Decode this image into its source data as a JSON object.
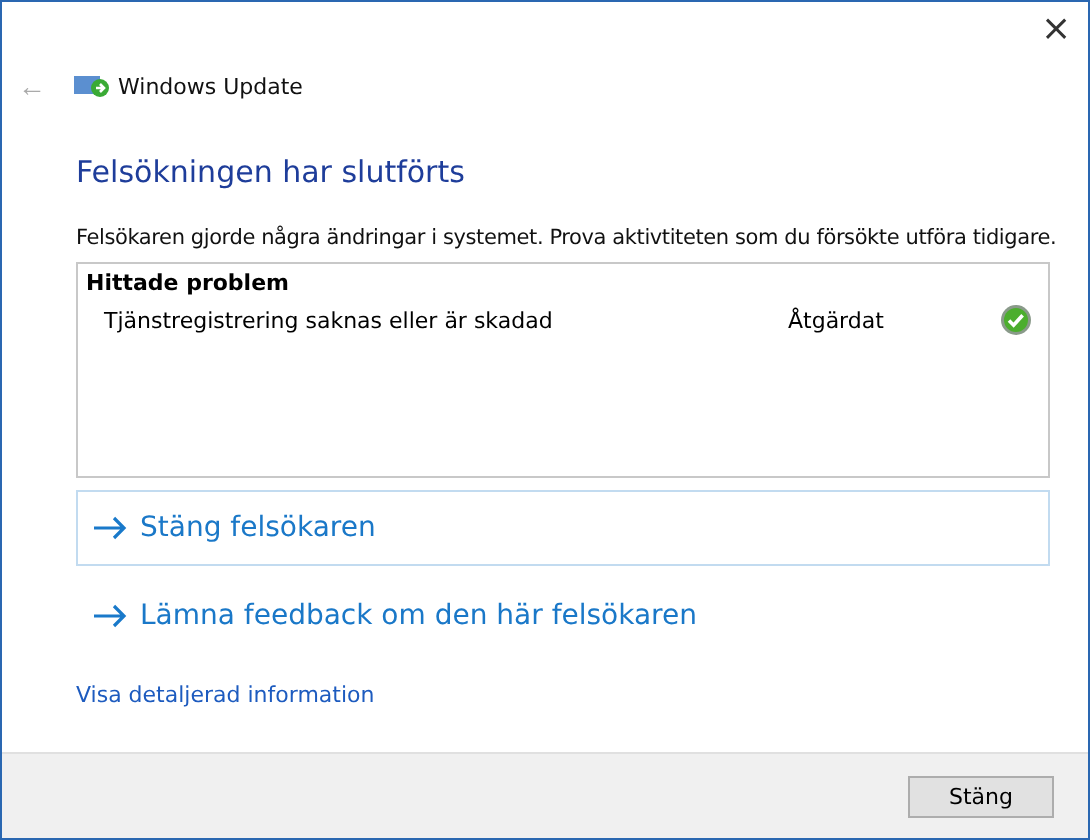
{
  "window": {
    "title": "Windows Update",
    "close": "×",
    "back": "←"
  },
  "heading": "Felsökningen har slutförts",
  "description": "Felsökaren gjorde några ändringar i systemet. Prova aktivtiteten som du försökte utföra tidigare.",
  "problems": {
    "header": "Hittade problem",
    "rows": [
      {
        "name": "Tjänstregistrering saknas eller är skadad",
        "status": "Åtgärdat",
        "kind": "fixed"
      }
    ]
  },
  "actions": [
    {
      "label": "Stäng felsökaren",
      "selected": true
    },
    {
      "label": "Lämna feedback om den här felsökaren",
      "selected": false
    }
  ],
  "details_link": "Visa detaljerad information",
  "buttons": [
    "Stäng"
  ]
}
